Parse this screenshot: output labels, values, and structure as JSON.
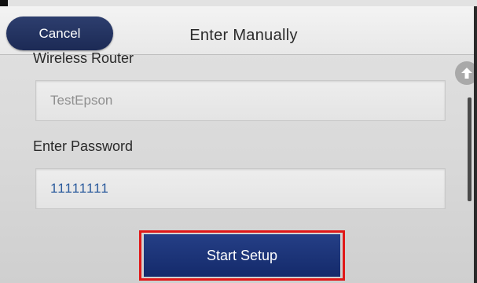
{
  "header": {
    "cancel_label": "Cancel",
    "title": "Enter Manually"
  },
  "form": {
    "ssid_label": "Wireless Router",
    "ssid_value": "TestEpson",
    "password_label": "Enter Password",
    "password_value": "11111111"
  },
  "actions": {
    "start_label": "Start Setup"
  },
  "scroll": {
    "up_icon": "arrow-up-icon"
  },
  "colors": {
    "button_navy": "#1c2a55",
    "highlight_red": "#e01818",
    "value_blue": "#2a5a9c"
  }
}
